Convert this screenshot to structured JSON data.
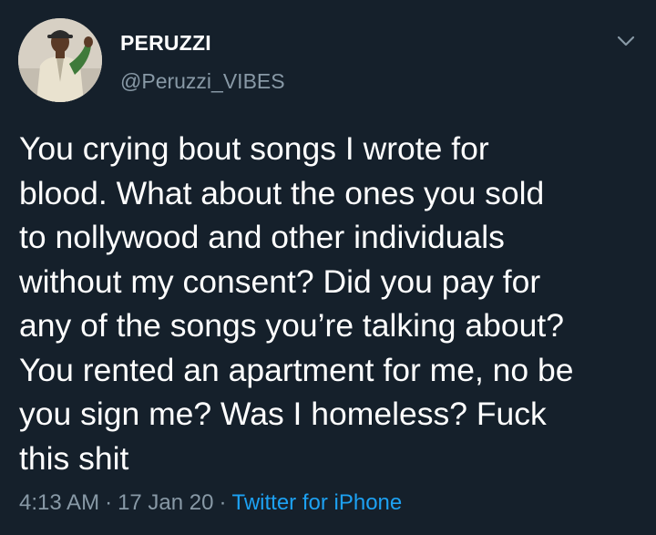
{
  "user": {
    "display_name": "PERUZZI",
    "handle": "@Peruzzi_VIBES"
  },
  "tweet": {
    "lines": [
      "You crying bout songs I wrote for",
      "blood. What about the ones you sold",
      "to nollywood and other individuals",
      "without my consent? Did you pay for",
      "any of the songs you’re talking about?",
      "You rented an apartment for me, no be",
      "you sign me? Was I homeless? Fuck",
      "this shit"
    ]
  },
  "meta": {
    "time": "4:13 AM",
    "separator": "·",
    "date": "17 Jan 20",
    "source": "Twitter for iPhone"
  },
  "icons": {
    "menu": "chevron-down-icon"
  },
  "colors": {
    "background": "#15202b",
    "text": "#ffffff",
    "secondary": "#8899a6",
    "accent": "#1da1f2"
  }
}
